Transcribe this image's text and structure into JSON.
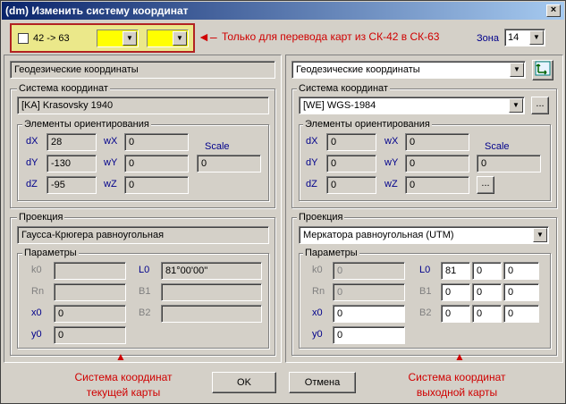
{
  "window": {
    "title": "(dm) Изменить систему координат",
    "close": "×"
  },
  "top": {
    "checkbox_label": "42 -> 63",
    "note": "Только для перевода карт из СК-42 в СК-63",
    "zone_label": "Зона",
    "zone_value": "14"
  },
  "left": {
    "coord_type": "Геодезические координаты",
    "system_group": "Система координат",
    "system_value": "[KA] Krasovsky 1940",
    "orient_group": "Элементы ориентирования",
    "dX": "28",
    "dY": "-130",
    "dZ": "-95",
    "wX": "0",
    "wY": "0",
    "wZ": "0",
    "scale": "0",
    "projection_group": "Проекция",
    "projection_value": "Гаусса-Крюгера равноугольная",
    "params_group": "Параметры",
    "k0": "",
    "Rn": "",
    "x0": "0",
    "y0": "0",
    "L0": "81°00'00''",
    "B1": "",
    "B2": "",
    "caption": [
      "Система координат",
      "текущей карты"
    ]
  },
  "right": {
    "coord_type": "Геодезические координаты",
    "system_group": "Система координат",
    "system_value": "[WE] WGS-1984",
    "orient_group": "Элементы ориентирования",
    "dX": "0",
    "dY": "0",
    "dZ": "0",
    "wX": "0",
    "wY": "0",
    "wZ": "0",
    "scale": "0",
    "projection_group": "Проекция",
    "projection_value": "Меркатора равноугольная (UTM)",
    "params_group": "Параметры",
    "k0": "0",
    "Rn": "0",
    "x0": "0",
    "y0": "0",
    "L0": [
      "81",
      "0",
      "0"
    ],
    "B1": [
      "0",
      "0",
      "0"
    ],
    "B2": [
      "0",
      "0",
      "0"
    ],
    "caption": [
      "Система координат",
      "выходной карты"
    ]
  },
  "labels": {
    "dX": "dX",
    "dY": "dY",
    "dZ": "dZ",
    "wX": "wX",
    "wY": "wY",
    "wZ": "wZ",
    "scale": "Scale",
    "k0": "k0",
    "Rn": "Rn",
    "x0": "x0",
    "y0": "y0",
    "L0": "L0",
    "B1": "B1",
    "B2": "B2"
  },
  "buttons": {
    "ok": "OK",
    "cancel": "Отмена",
    "dots": "..."
  }
}
